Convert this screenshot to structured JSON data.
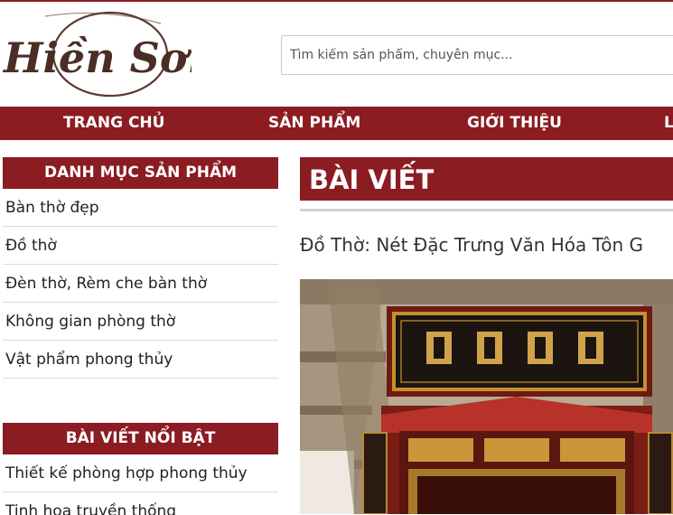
{
  "brand": {
    "logo_text": "Hiền Sơn",
    "accent": "#8b1c22"
  },
  "search": {
    "placeholder": "Tìm kiếm sản phẩm, chuyên mục..."
  },
  "nav": {
    "items": [
      "TRANG CHỦ",
      "SẢN PHẨM",
      "GIỚI THIỆU",
      "L"
    ]
  },
  "sidebar": {
    "categories": {
      "title": "DANH MỤC SẢN PHẨM",
      "items": [
        "Bàn thờ đẹp",
        "Đồ thờ",
        "Đèn thờ, Rèm che bàn thờ",
        "Không gian phòng thờ",
        "Vật phẩm phong thủy"
      ]
    },
    "featured": {
      "title": "BÀI VIẾT NỔI BẬT",
      "items": [
        "Thiết kế phòng hợp phong thủy",
        "Tinh hoa truyền thống"
      ]
    }
  },
  "main": {
    "heading": "BÀI VIẾT",
    "post_title": "Đồ Thờ: Nét Đặc Trưng Văn Hóa Tôn G",
    "image_icon": "altar-photo"
  }
}
